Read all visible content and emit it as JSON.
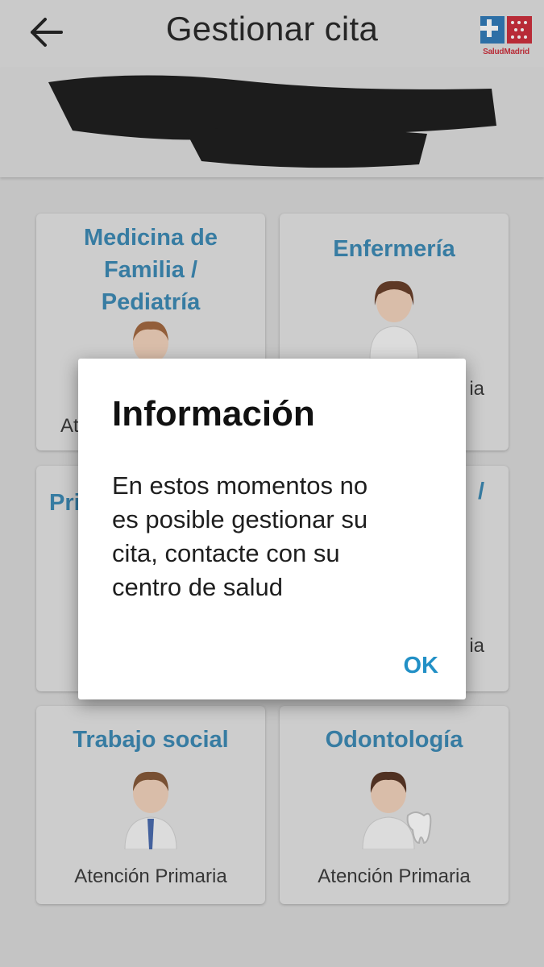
{
  "appbar": {
    "title": "Gestionar cita",
    "back_icon": "arrow-left-icon",
    "logo_text": "SaludMadrid"
  },
  "colors": {
    "accent_blue": "#2b7fae",
    "ok_blue": "#2290c6",
    "logo_red": "#c81d2b"
  },
  "cards": [
    {
      "title": "Medicina de Familia / Pediatría",
      "title_lines": [
        "Medicina de",
        "Familia /",
        "Pediatría"
      ],
      "subtitle": "At"
    },
    {
      "title": "Enfermería",
      "subtitle": "ia"
    },
    {
      "title": "Pri",
      "subtitle": ""
    },
    {
      "title": "/",
      "subtitle": "ia"
    },
    {
      "title": "Trabajo social",
      "subtitle": "Atención Primaria"
    },
    {
      "title": "Odontología",
      "subtitle": "Atención Primaria"
    }
  ],
  "dialog": {
    "title": "Información",
    "message": "En estos momentos no es posible gestionar su cita, contacte con su centro de salud",
    "message_lines": [
      "En estos momentos no",
      "es posible gestionar su",
      "cita, contacte con su",
      "centro de salud"
    ],
    "ok_label": "OK"
  }
}
